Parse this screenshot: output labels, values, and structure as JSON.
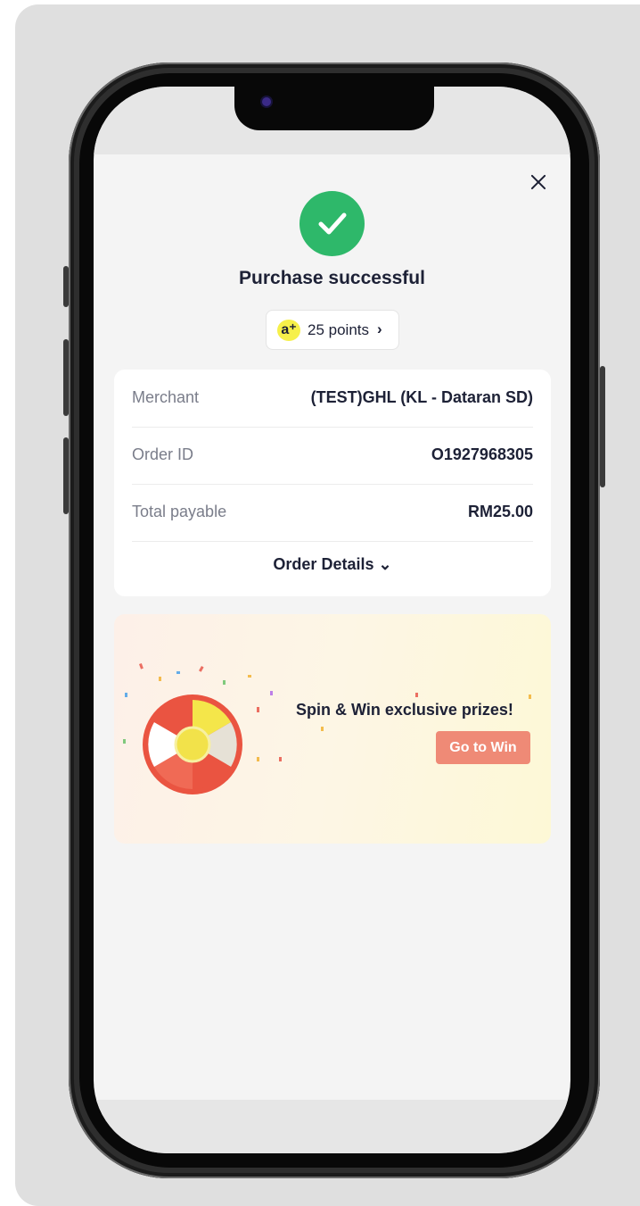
{
  "screen": {
    "title": "Purchase successful",
    "points": {
      "label": "25 points",
      "logo": "a⁺",
      "chevron": "›"
    },
    "summary": {
      "rows": [
        {
          "label": "Merchant",
          "value": "(TEST)GHL (KL - Dataran SD)"
        },
        {
          "label": "Order ID",
          "value": "O1927968305"
        },
        {
          "label": "Total payable",
          "value": "RM25.00"
        }
      ],
      "details_link": "Order Details ⌄"
    },
    "promo": {
      "headline": "Spin & Win exclusive prizes!",
      "button": "Go to Win"
    }
  },
  "icons": [
    "close-icon",
    "success-check-icon",
    "points-logo-icon",
    "chevron-right-icon",
    "chevron-down-icon",
    "spin-wheel-icon"
  ],
  "colors": {
    "success": "#2eb86a",
    "accent": "#ef8a76",
    "points_badge": "#f6f04a",
    "text": "#1d2136"
  }
}
